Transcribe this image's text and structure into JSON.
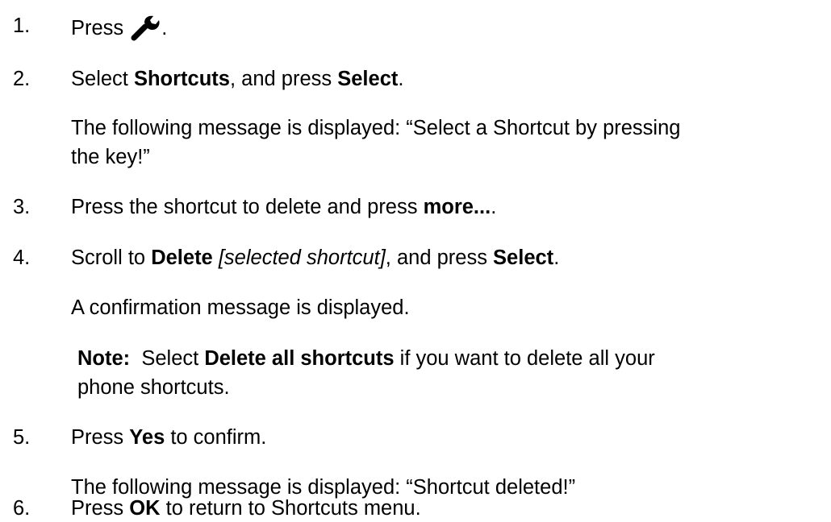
{
  "steps": [
    {
      "number": "1.",
      "pre": "Press ",
      "icon": "wrench-icon",
      "post": "."
    },
    {
      "number": "2.",
      "pre": "Select ",
      "b1": "Shortcuts",
      "mid": ", and press ",
      "b2": "Select",
      "post": ".",
      "detail_line1": "The following message is displayed: “Select a Shortcut by pressing",
      "detail_line2": "the key!”"
    },
    {
      "number": "3.",
      "pre": "Press the shortcut to delete and press ",
      "b1": "more...",
      "post": "."
    },
    {
      "number": "4.",
      "pre": "Scroll to ",
      "b1": "Delete",
      "space": " ",
      "i1": "[selected shortcut]",
      "mid": ", and press ",
      "b2": "Select",
      "post": ".",
      "detail": "A confirmation message is displayed.",
      "note_label": "Note:",
      "note_pre": "  Select ",
      "note_b": "Delete all shortcuts",
      "note_post": " if you want to delete all your",
      "note_line2": "phone shortcuts."
    },
    {
      "number": "5.",
      "pre": "Press ",
      "b1": "Yes",
      "post": " to confirm.",
      "detail": "The following message is displayed: “Shortcut deleted!”"
    },
    {
      "number": "6.",
      "pre": "Press ",
      "b1": "OK",
      "post": " to return to Shortcuts menu."
    }
  ]
}
